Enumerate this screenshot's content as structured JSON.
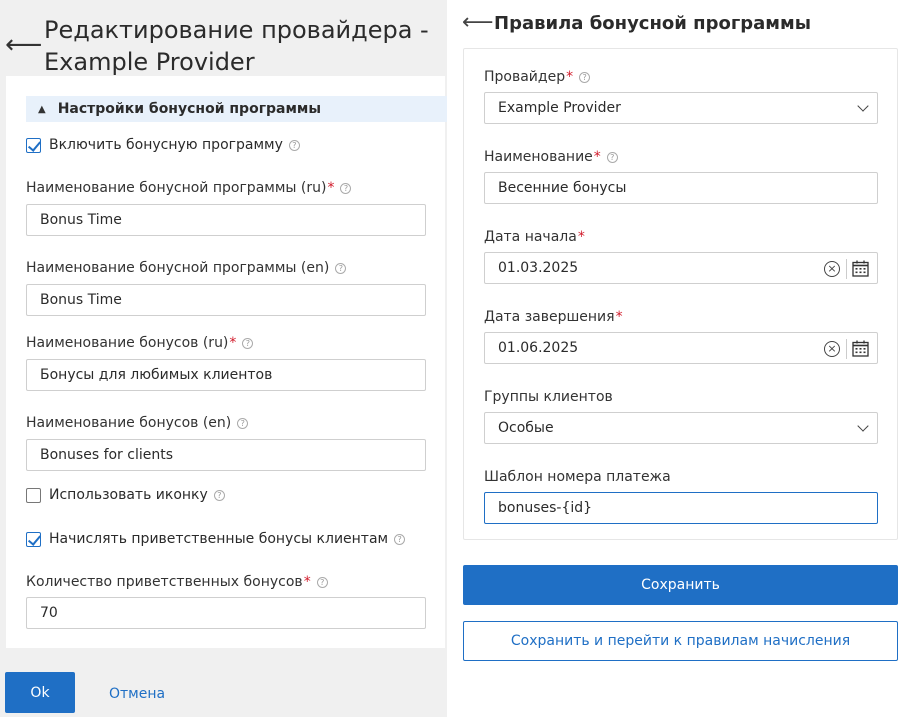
{
  "left": {
    "title": "Редактирование провайдера - Example Provider",
    "section_title": "Настройки бонусной программы",
    "enable_checkbox_label": "Включить бонусную программу",
    "program_name_ru_label": "Наименование бонусной программы (ru)",
    "program_name_ru_value": "Bonus Time",
    "program_name_en_label": "Наименование бонусной программы (en)",
    "program_name_en_value": "Bonus Time",
    "bonus_name_ru_label": "Наименование бонусов (ru)",
    "bonus_name_ru_value": "Бонусы для любимых клиентов",
    "bonus_name_en_label": "Наименование бонусов (en)",
    "bonus_name_en_value": "Bonuses for clients",
    "use_icon_label": "Использовать иконку",
    "welcome_bonus_label": "Начислять приветственные бонусы клиентам",
    "welcome_amount_label": "Количество приветственных бонусов",
    "welcome_amount_value": "70",
    "ok_label": "Ok",
    "cancel_label": "Отмена",
    "help_glyph": "?"
  },
  "right": {
    "title": "Правила бонусной программы",
    "provider_label": "Провайдер",
    "provider_value": "Example Provider",
    "name_label": "Наименование",
    "name_value": "Весенние бонусы",
    "start_label": "Дата начала",
    "start_value": "01.03.2025",
    "end_label": "Дата завершения",
    "end_value": "01.06.2025",
    "groups_label": "Группы клиентов",
    "groups_value": "Особые",
    "template_label": "Шаблон номера платежа",
    "template_value": "bonuses-{id}",
    "save_label": "Сохранить",
    "save_go_label": "Сохранить и перейти к правилам начисления"
  },
  "colors": {
    "accent": "#1f6fc5",
    "required": "#d11a2a",
    "section_bg": "#e8f1fb"
  }
}
